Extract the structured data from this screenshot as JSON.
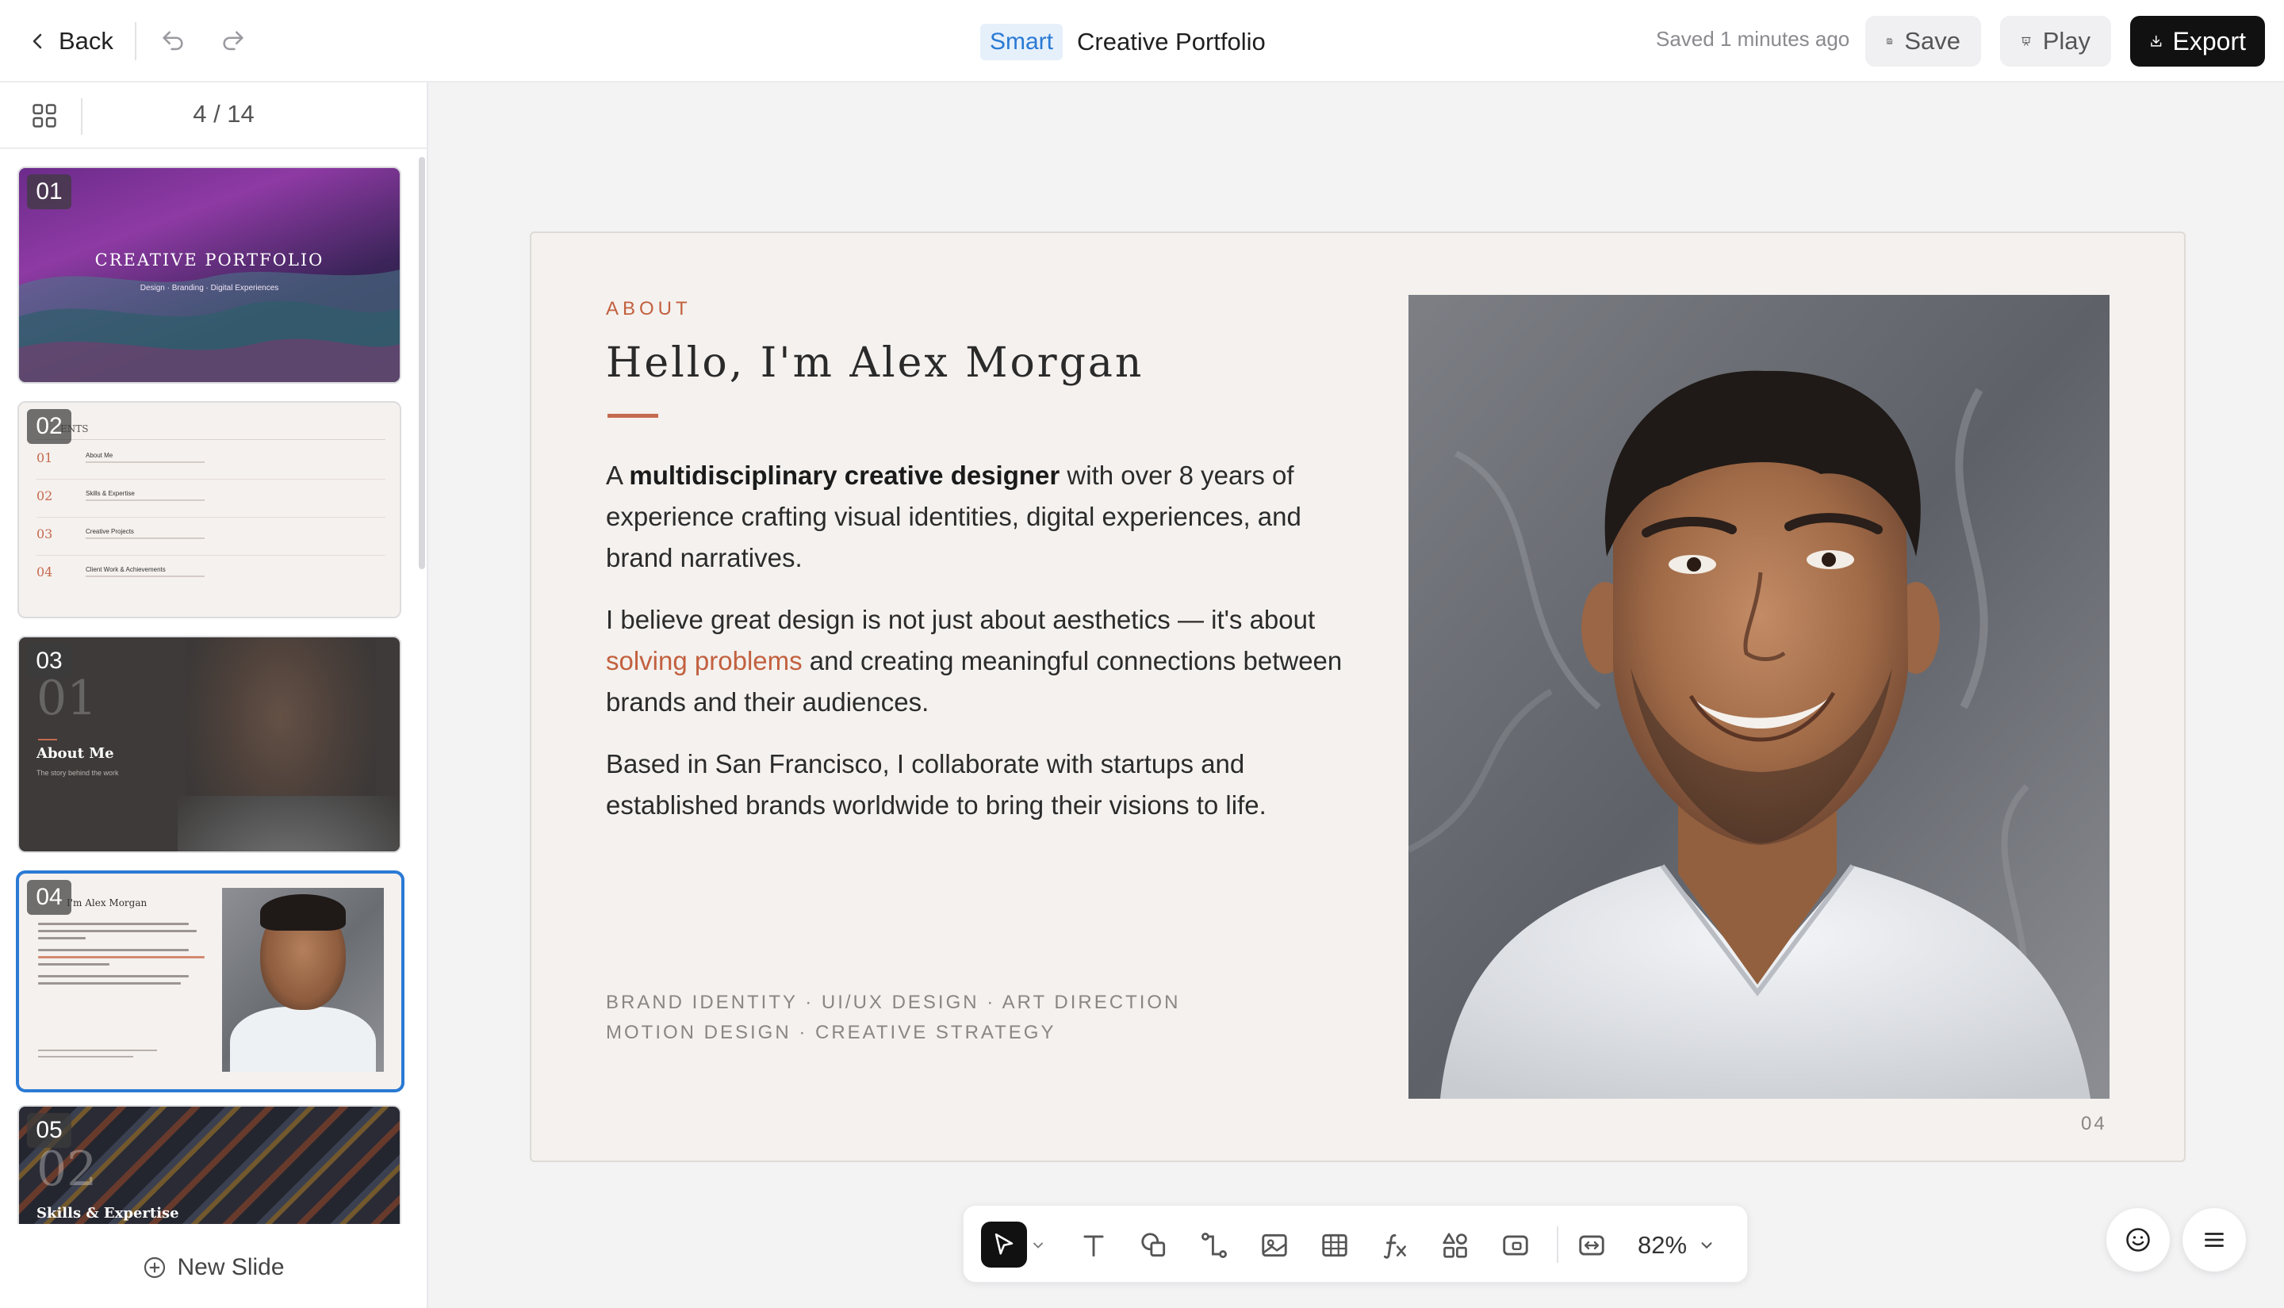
{
  "topbar": {
    "back_label": "Back",
    "smart_badge": "Smart",
    "doc_title": "Creative Portfolio",
    "saved_status": "Saved 1 minutes ago",
    "save_label": "Save",
    "play_label": "Play",
    "export_label": "Export"
  },
  "sidebar": {
    "page_indicator": "4 / 14",
    "new_slide_label": "New Slide",
    "thumbnails": [
      {
        "num": "01",
        "title": "CREATIVE PORTFOLIO",
        "subtitle": "Design · Branding · Digital Experiences"
      },
      {
        "num": "02",
        "heading": "ENTS",
        "items": [
          {
            "n": "01",
            "label": "About Me"
          },
          {
            "n": "02",
            "label": "Skills & Expertise"
          },
          {
            "n": "03",
            "label": "Creative Projects"
          },
          {
            "n": "04",
            "label": "Client Work & Achievements"
          }
        ]
      },
      {
        "num": "03",
        "big": "01",
        "title": "About Me",
        "subtitle": "The story behind the work"
      },
      {
        "num": "04",
        "heading": "I'm Alex Morgan"
      },
      {
        "num": "05",
        "big": "02",
        "title": "Skills & Expertise"
      }
    ]
  },
  "slide": {
    "eyebrow": "ABOUT",
    "heading": "Hello, I'm Alex Morgan",
    "p1_pre": "A ",
    "p1_bold": "multidisciplinary creative designer",
    "p1_post": " with over 8 years of experience crafting visual identities, digital experiences, and brand narratives.",
    "p2_pre": "I believe great design is not just about aesthetics — it's about ",
    "p2_accent": "solving problems",
    "p2_post": " and creating meaningful connections between brands and their audiences.",
    "p3": "Based in San Francisco, I collaborate with startups and established brands worldwide to bring their visions to life.",
    "tags_line1": "BRAND IDENTITY · UI/UX DESIGN · ART DIRECTION",
    "tags_line2": "MOTION DESIGN · CREATIVE STRATEGY",
    "page_number": "04"
  },
  "toolbar": {
    "zoom": "82%"
  },
  "colors": {
    "accent": "#c2603f",
    "brand_blue": "#2a7ad4",
    "slide_bg": "#f4f1ee",
    "export_bg": "#111111"
  },
  "icons": [
    "chevron-left-icon",
    "undo-icon",
    "redo-icon",
    "save-icon",
    "play-icon",
    "download-icon",
    "grid-icon",
    "plus-circle-icon",
    "pointer-icon",
    "text-icon",
    "shapes-icon",
    "connector-icon",
    "image-icon",
    "table-icon",
    "formula-icon",
    "widgets-icon",
    "media-icon",
    "fit-icon",
    "chevron-down-icon",
    "smiley-icon",
    "menu-icon"
  ]
}
